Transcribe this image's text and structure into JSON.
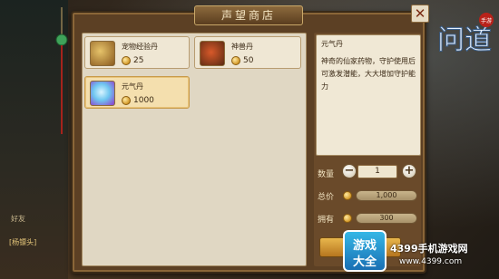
{
  "window": {
    "title": "声望商店",
    "close_glyph": "✕"
  },
  "items": [
    {
      "name": "宠物经验丹",
      "price": "25",
      "icon": "pet-exp-pill-icon"
    },
    {
      "name": "神兽丹",
      "price": "50",
      "icon": "divine-beast-pill-icon"
    },
    {
      "name": "元气丹",
      "price": "1000",
      "icon": "vitality-pill-icon",
      "selected": true
    }
  ],
  "detail": {
    "title": "元气丹",
    "description": "神奇的仙家药物，守护使用后可激发潜能，大大增加守护能力"
  },
  "purchase": {
    "quantity_label": "数量",
    "quantity": "1",
    "minus": "−",
    "plus": "+",
    "total_label": "总价",
    "total": "1,000",
    "owned_label": "拥有",
    "owned": "300"
  },
  "side": {
    "line1": "好友",
    "line2": "[杨镖头]"
  },
  "game_logo": {
    "text": "问道",
    "tag": "手游"
  },
  "watermark": {
    "badge_top": "游戏",
    "badge_bottom": "大全",
    "site": "4399手机游戏网",
    "url": "www.4399.com"
  },
  "colors": {
    "frame": "#5c4024",
    "panel": "#e0d7c3",
    "accent": "#e8b64c",
    "selected": "#f4dfae"
  }
}
